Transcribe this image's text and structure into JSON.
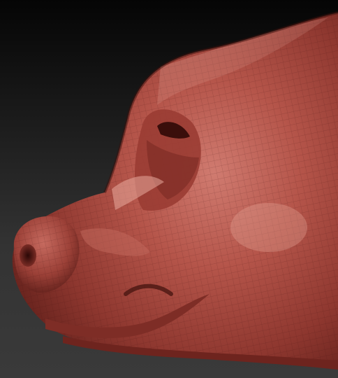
{
  "scene": {
    "subject": "sculpted-animal-snout",
    "material_color": "#a8483f",
    "highlight_color": "#e1a093",
    "shadow_color": "#4a1612",
    "background_top": "#050505",
    "background_bottom": "#3a3a3a"
  }
}
